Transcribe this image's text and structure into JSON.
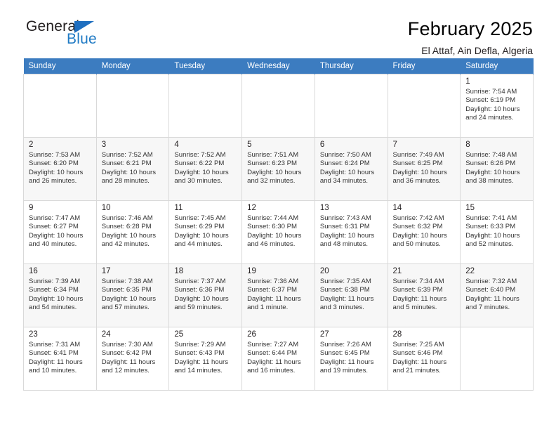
{
  "brand": {
    "name_top": "General",
    "name_bottom": "Blue",
    "triangle_icon": "triangle-icon",
    "accent_color": "#1f7ac4"
  },
  "header": {
    "month_title": "February 2025",
    "location": "El Attaf, Ain Defla, Algeria"
  },
  "calendar": {
    "header_bg": "#3c7cc0",
    "weekdays": [
      "Sunday",
      "Monday",
      "Tuesday",
      "Wednesday",
      "Thursday",
      "Friday",
      "Saturday"
    ],
    "labels": {
      "sunrise": "Sunrise:",
      "sunset": "Sunset:",
      "daylight": "Daylight:"
    },
    "weeks": [
      [
        {
          "day": "",
          "empty": true
        },
        {
          "day": "",
          "empty": true
        },
        {
          "day": "",
          "empty": true
        },
        {
          "day": "",
          "empty": true
        },
        {
          "day": "",
          "empty": true
        },
        {
          "day": "",
          "empty": true
        },
        {
          "day": "1",
          "sunrise": "Sunrise: 7:54 AM",
          "sunset": "Sunset: 6:19 PM",
          "daylight_line1": "Daylight: 10 hours",
          "daylight_line2": "and 24 minutes."
        }
      ],
      [
        {
          "day": "2",
          "sunrise": "Sunrise: 7:53 AM",
          "sunset": "Sunset: 6:20 PM",
          "daylight_line1": "Daylight: 10 hours",
          "daylight_line2": "and 26 minutes."
        },
        {
          "day": "3",
          "sunrise": "Sunrise: 7:52 AM",
          "sunset": "Sunset: 6:21 PM",
          "daylight_line1": "Daylight: 10 hours",
          "daylight_line2": "and 28 minutes."
        },
        {
          "day": "4",
          "sunrise": "Sunrise: 7:52 AM",
          "sunset": "Sunset: 6:22 PM",
          "daylight_line1": "Daylight: 10 hours",
          "daylight_line2": "and 30 minutes."
        },
        {
          "day": "5",
          "sunrise": "Sunrise: 7:51 AM",
          "sunset": "Sunset: 6:23 PM",
          "daylight_line1": "Daylight: 10 hours",
          "daylight_line2": "and 32 minutes."
        },
        {
          "day": "6",
          "sunrise": "Sunrise: 7:50 AM",
          "sunset": "Sunset: 6:24 PM",
          "daylight_line1": "Daylight: 10 hours",
          "daylight_line2": "and 34 minutes."
        },
        {
          "day": "7",
          "sunrise": "Sunrise: 7:49 AM",
          "sunset": "Sunset: 6:25 PM",
          "daylight_line1": "Daylight: 10 hours",
          "daylight_line2": "and 36 minutes."
        },
        {
          "day": "8",
          "sunrise": "Sunrise: 7:48 AM",
          "sunset": "Sunset: 6:26 PM",
          "daylight_line1": "Daylight: 10 hours",
          "daylight_line2": "and 38 minutes."
        }
      ],
      [
        {
          "day": "9",
          "sunrise": "Sunrise: 7:47 AM",
          "sunset": "Sunset: 6:27 PM",
          "daylight_line1": "Daylight: 10 hours",
          "daylight_line2": "and 40 minutes."
        },
        {
          "day": "10",
          "sunrise": "Sunrise: 7:46 AM",
          "sunset": "Sunset: 6:28 PM",
          "daylight_line1": "Daylight: 10 hours",
          "daylight_line2": "and 42 minutes."
        },
        {
          "day": "11",
          "sunrise": "Sunrise: 7:45 AM",
          "sunset": "Sunset: 6:29 PM",
          "daylight_line1": "Daylight: 10 hours",
          "daylight_line2": "and 44 minutes."
        },
        {
          "day": "12",
          "sunrise": "Sunrise: 7:44 AM",
          "sunset": "Sunset: 6:30 PM",
          "daylight_line1": "Daylight: 10 hours",
          "daylight_line2": "and 46 minutes."
        },
        {
          "day": "13",
          "sunrise": "Sunrise: 7:43 AM",
          "sunset": "Sunset: 6:31 PM",
          "daylight_line1": "Daylight: 10 hours",
          "daylight_line2": "and 48 minutes."
        },
        {
          "day": "14",
          "sunrise": "Sunrise: 7:42 AM",
          "sunset": "Sunset: 6:32 PM",
          "daylight_line1": "Daylight: 10 hours",
          "daylight_line2": "and 50 minutes."
        },
        {
          "day": "15",
          "sunrise": "Sunrise: 7:41 AM",
          "sunset": "Sunset: 6:33 PM",
          "daylight_line1": "Daylight: 10 hours",
          "daylight_line2": "and 52 minutes."
        }
      ],
      [
        {
          "day": "16",
          "sunrise": "Sunrise: 7:39 AM",
          "sunset": "Sunset: 6:34 PM",
          "daylight_line1": "Daylight: 10 hours",
          "daylight_line2": "and 54 minutes."
        },
        {
          "day": "17",
          "sunrise": "Sunrise: 7:38 AM",
          "sunset": "Sunset: 6:35 PM",
          "daylight_line1": "Daylight: 10 hours",
          "daylight_line2": "and 57 minutes."
        },
        {
          "day": "18",
          "sunrise": "Sunrise: 7:37 AM",
          "sunset": "Sunset: 6:36 PM",
          "daylight_line1": "Daylight: 10 hours",
          "daylight_line2": "and 59 minutes."
        },
        {
          "day": "19",
          "sunrise": "Sunrise: 7:36 AM",
          "sunset": "Sunset: 6:37 PM",
          "daylight_line1": "Daylight: 11 hours",
          "daylight_line2": "and 1 minute."
        },
        {
          "day": "20",
          "sunrise": "Sunrise: 7:35 AM",
          "sunset": "Sunset: 6:38 PM",
          "daylight_line1": "Daylight: 11 hours",
          "daylight_line2": "and 3 minutes."
        },
        {
          "day": "21",
          "sunrise": "Sunrise: 7:34 AM",
          "sunset": "Sunset: 6:39 PM",
          "daylight_line1": "Daylight: 11 hours",
          "daylight_line2": "and 5 minutes."
        },
        {
          "day": "22",
          "sunrise": "Sunrise: 7:32 AM",
          "sunset": "Sunset: 6:40 PM",
          "daylight_line1": "Daylight: 11 hours",
          "daylight_line2": "and 7 minutes."
        }
      ],
      [
        {
          "day": "23",
          "sunrise": "Sunrise: 7:31 AM",
          "sunset": "Sunset: 6:41 PM",
          "daylight_line1": "Daylight: 11 hours",
          "daylight_line2": "and 10 minutes."
        },
        {
          "day": "24",
          "sunrise": "Sunrise: 7:30 AM",
          "sunset": "Sunset: 6:42 PM",
          "daylight_line1": "Daylight: 11 hours",
          "daylight_line2": "and 12 minutes."
        },
        {
          "day": "25",
          "sunrise": "Sunrise: 7:29 AM",
          "sunset": "Sunset: 6:43 PM",
          "daylight_line1": "Daylight: 11 hours",
          "daylight_line2": "and 14 minutes."
        },
        {
          "day": "26",
          "sunrise": "Sunrise: 7:27 AM",
          "sunset": "Sunset: 6:44 PM",
          "daylight_line1": "Daylight: 11 hours",
          "daylight_line2": "and 16 minutes."
        },
        {
          "day": "27",
          "sunrise": "Sunrise: 7:26 AM",
          "sunset": "Sunset: 6:45 PM",
          "daylight_line1": "Daylight: 11 hours",
          "daylight_line2": "and 19 minutes."
        },
        {
          "day": "28",
          "sunrise": "Sunrise: 7:25 AM",
          "sunset": "Sunset: 6:46 PM",
          "daylight_line1": "Daylight: 11 hours",
          "daylight_line2": "and 21 minutes."
        },
        {
          "day": "",
          "empty": true
        }
      ]
    ]
  }
}
